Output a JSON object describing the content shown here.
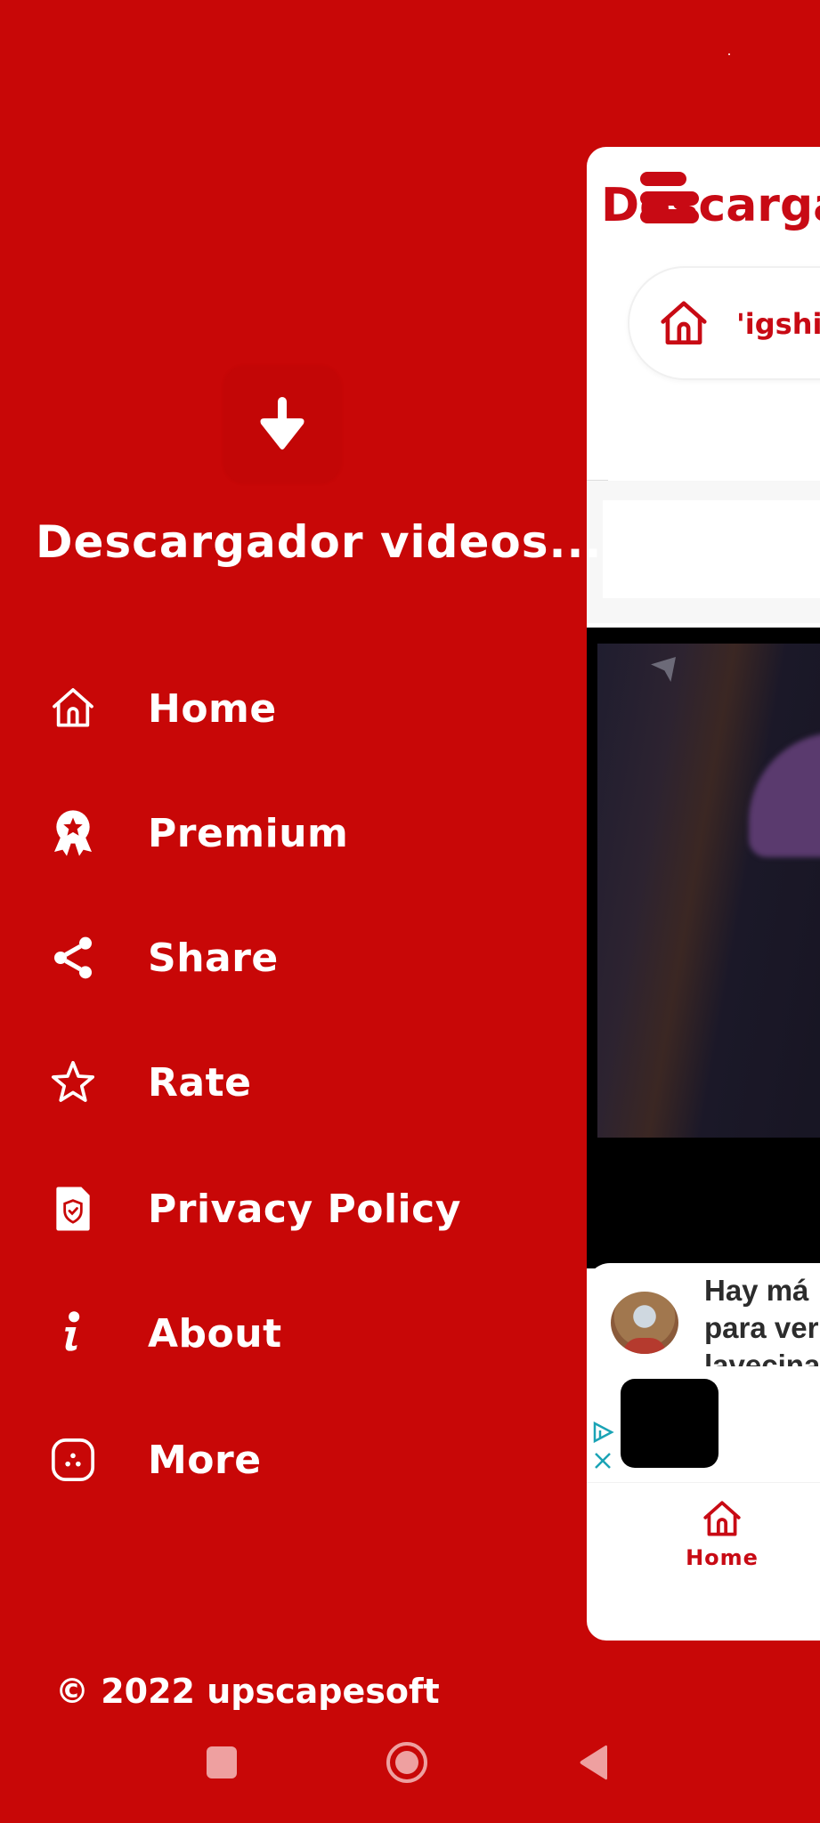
{
  "drawer": {
    "app_name": "Descargador videos...",
    "logo_icon": "download-arrow-icon",
    "menu": [
      {
        "label": "Home",
        "icon": "home-icon"
      },
      {
        "label": "Premium",
        "icon": "award-badge-icon"
      },
      {
        "label": "Share",
        "icon": "share-icon"
      },
      {
        "label": "Rate",
        "icon": "star-outline-icon"
      },
      {
        "label": "Privacy Policy",
        "icon": "privacy-document-shield-icon"
      },
      {
        "label": "About",
        "icon": "info-icon"
      },
      {
        "label": "More",
        "icon": "more-apps-icon"
      }
    ],
    "copyright": "© 2022 upscapesoft"
  },
  "main": {
    "title": "Descargad",
    "url_bar": {
      "text": "'igshi",
      "icon": "home-icon"
    },
    "ad": {
      "headline_lines": [
        "Hay má",
        "para ver",
        "lavecina"
      ],
      "adchoices_icon": "adchoices-icon",
      "close_icon": "close-icon"
    },
    "bottom_nav": {
      "home_label": "Home"
    }
  },
  "system_nav": {
    "recents": "recents-icon",
    "home": "home-circle-icon",
    "back": "back-triangle-icon"
  },
  "colors": {
    "brand_red": "#c80707",
    "accent_red": "#c80a14",
    "white": "#ffffff",
    "adchoices_teal": "#1aa3b5"
  }
}
